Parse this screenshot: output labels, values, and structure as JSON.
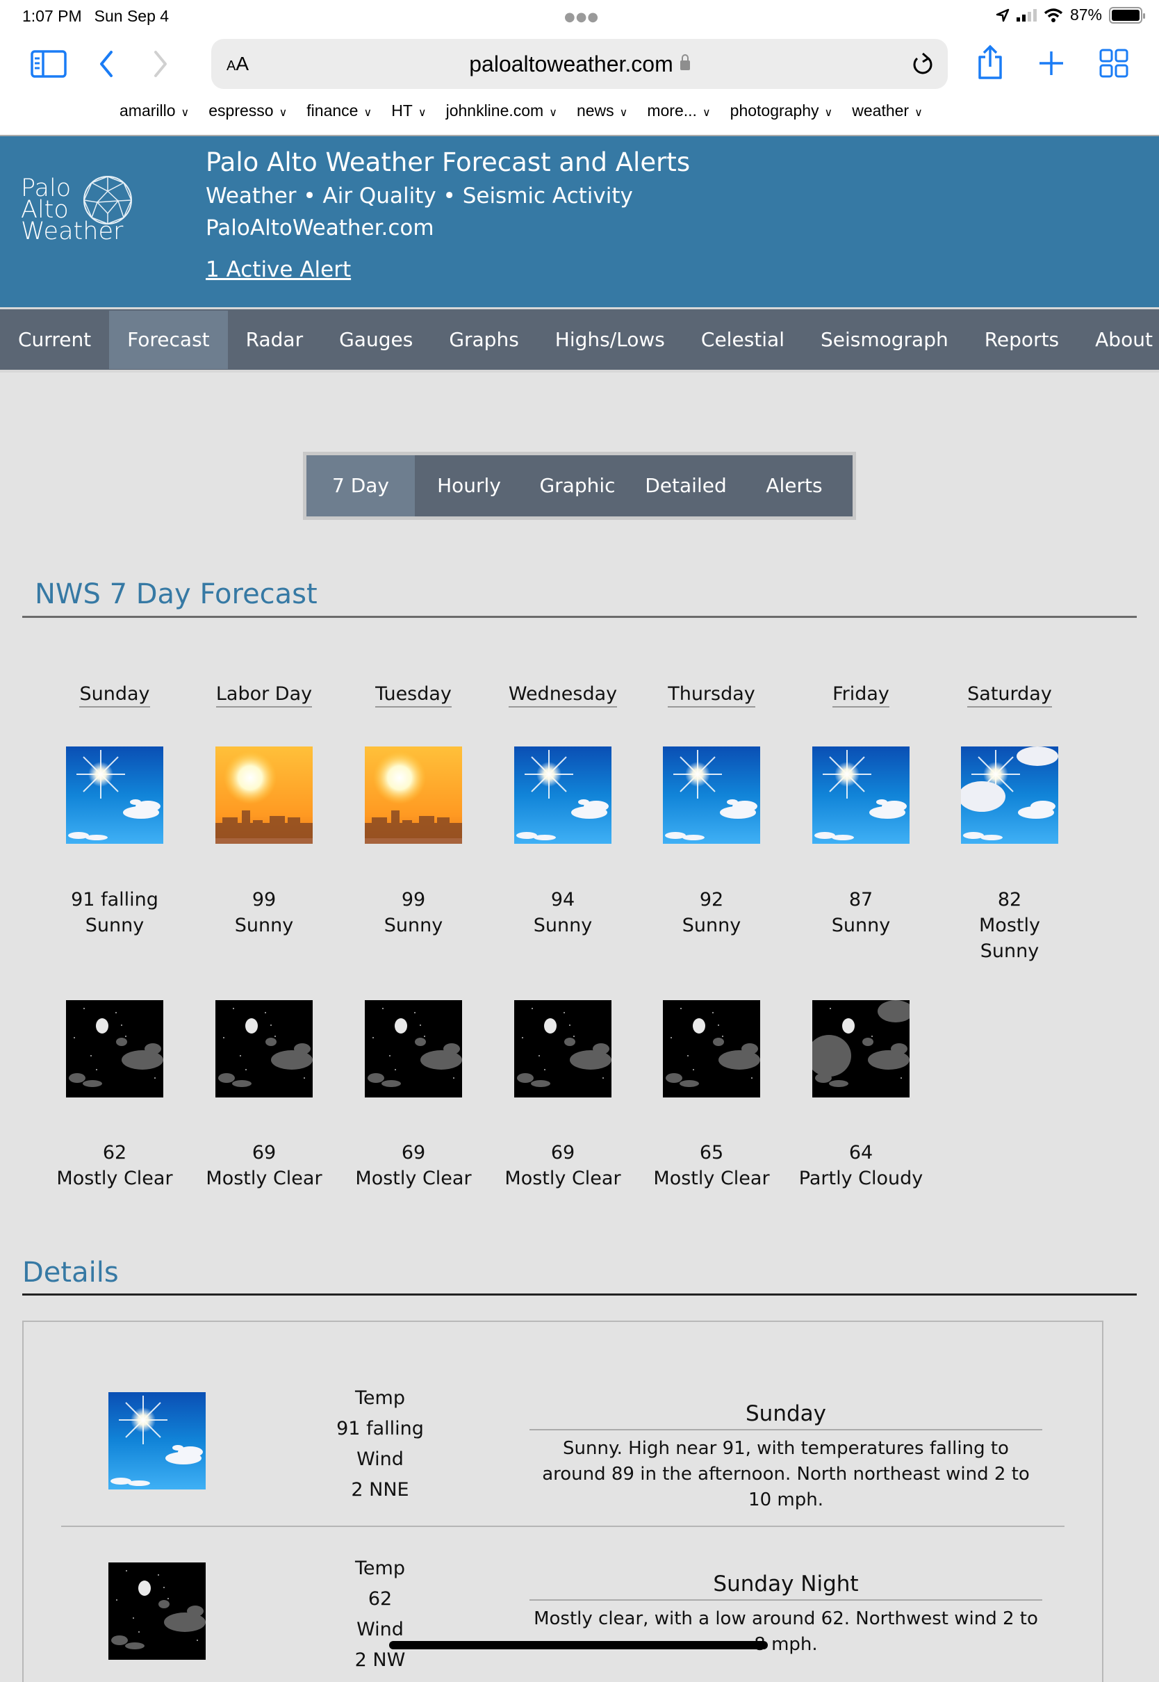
{
  "status_bar": {
    "time": "1:07 PM",
    "date": "Sun Sep 4",
    "battery": "87%",
    "battery_level": 0.87
  },
  "browser": {
    "text_size_label": "AA",
    "url": "paloaltoweather.com",
    "bookmarks": [
      "amarillo",
      "espresso",
      "finance",
      "HT",
      "johnkline.com",
      "news",
      "more...",
      "photography",
      "weather"
    ]
  },
  "header": {
    "logo_lines": [
      "Palo",
      "Alto",
      "Weather"
    ],
    "title": "Palo Alto Weather Forecast and Alerts",
    "subtitle": "Weather • Air Quality • Seismic Activity",
    "site": "PaloAltoWeather.com",
    "alert_link": "1 Active Alert"
  },
  "nav": {
    "items": [
      "Current",
      "Forecast",
      "Radar",
      "Gauges",
      "Graphs",
      "Highs/Lows",
      "Celestial",
      "Seismograph",
      "Reports",
      "About"
    ],
    "active": "Forecast"
  },
  "subtabs": {
    "items": [
      "7 Day",
      "Hourly",
      "Graphic",
      "Detailed",
      "Alerts"
    ],
    "active": "7 Day"
  },
  "forecast": {
    "section_title": "NWS 7 Day Forecast",
    "days": [
      {
        "name": "Sunday",
        "day_icon": "sunny-icon",
        "day_temp": "91 falling",
        "day_cond": "Sunny",
        "night_icon": "mostly-clear-night-icon",
        "night_temp": "62",
        "night_cond": "Mostly Clear"
      },
      {
        "name": "Labor Day",
        "day_icon": "hot-icon",
        "day_temp": "99",
        "day_cond": "Sunny",
        "night_icon": "mostly-clear-night-icon",
        "night_temp": "69",
        "night_cond": "Mostly Clear"
      },
      {
        "name": "Tuesday",
        "day_icon": "hot-icon",
        "day_temp": "99",
        "day_cond": "Sunny",
        "night_icon": "mostly-clear-night-icon",
        "night_temp": "69",
        "night_cond": "Mostly Clear"
      },
      {
        "name": "Wednesday",
        "day_icon": "sunny-icon",
        "day_temp": "94",
        "day_cond": "Sunny",
        "night_icon": "mostly-clear-night-icon",
        "night_temp": "69",
        "night_cond": "Mostly Clear"
      },
      {
        "name": "Thursday",
        "day_icon": "sunny-icon",
        "day_temp": "92",
        "day_cond": "Sunny",
        "night_icon": "mostly-clear-night-icon",
        "night_temp": "65",
        "night_cond": "Mostly Clear"
      },
      {
        "name": "Friday",
        "day_icon": "sunny-icon",
        "day_temp": "87",
        "day_cond": "Sunny",
        "night_icon": "partly-cloudy-night-icon",
        "night_temp": "64",
        "night_cond": "Partly Cloudy"
      },
      {
        "name": "Saturday",
        "day_icon": "mostly-sunny-icon",
        "day_temp": "82",
        "day_cond": "Mostly Sunny"
      }
    ]
  },
  "details": {
    "section_title": "Details",
    "rows": [
      {
        "icon": "sunny-icon",
        "temp_label": "Temp",
        "temp": "91 falling",
        "wind_label": "Wind",
        "wind": "2 NNE",
        "title": "Sunday",
        "desc": "Sunny. High near 91, with temperatures falling to around 89 in the afternoon. North northeast wind 2 to 10 mph."
      },
      {
        "icon": "mostly-clear-night-icon",
        "temp_label": "Temp",
        "temp": "62",
        "wind_label": "Wind",
        "wind": "2 NW",
        "title": "Sunday Night",
        "desc": "Mostly clear, with a low around 62. Northwest wind 2 to 8 mph."
      }
    ]
  },
  "colors": {
    "header_bg": "#3679a4",
    "nav_bg": "#5b6674",
    "nav_active": "#6e7e8f",
    "accent_text": "#3679a4",
    "ios_blue": "#1a7cf5"
  }
}
